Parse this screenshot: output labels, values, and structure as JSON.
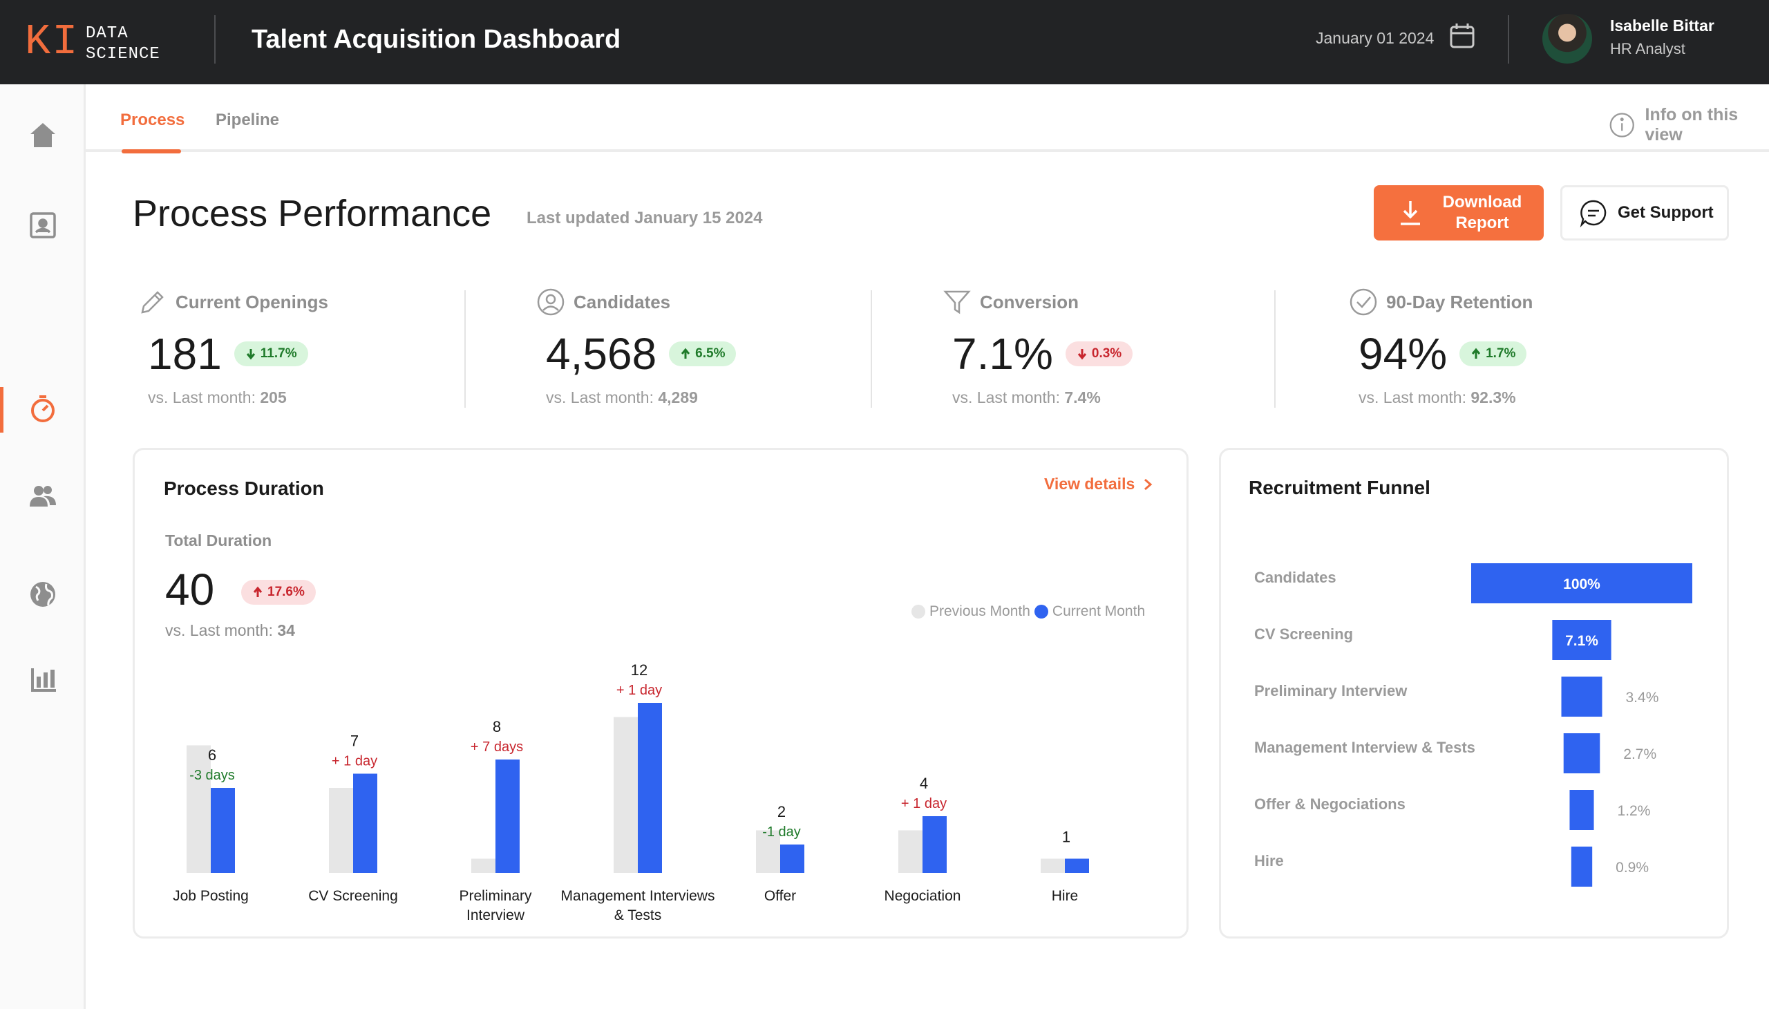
{
  "brand": {
    "logo_mark": "KI",
    "logo_text": "DATA\nSCIENCE",
    "accent": "#f26d3d"
  },
  "header": {
    "title": "Talent Acquisition Dashboard",
    "date": "January 01 2024",
    "user_name": "Isabelle Bittar",
    "user_role": "HR Analyst"
  },
  "sidebar": {
    "items": [
      {
        "icon": "home-icon",
        "active": false
      },
      {
        "icon": "id-card-icon",
        "active": false
      },
      {
        "icon": "timer-icon",
        "active": true
      },
      {
        "icon": "people-icon",
        "active": false
      },
      {
        "icon": "globe-icon",
        "active": false
      },
      {
        "icon": "bar-chart-icon",
        "active": false
      }
    ]
  },
  "tabs": {
    "process": "Process",
    "pipeline": "Pipeline",
    "active": "Process",
    "info": "Info on this view"
  },
  "page": {
    "title": "Process Performance",
    "last_updated": "Last updated January 15 2024",
    "download_label": "Download Report",
    "support_label": "Get Support"
  },
  "kpis": [
    {
      "label": "Current Openings",
      "icon": "pencil-icon",
      "value": "181",
      "change": "11.7%",
      "direction": "down",
      "tone": "green",
      "sub_label": "vs. Last month:",
      "sub_value": "205"
    },
    {
      "label": "Candidates",
      "icon": "user-circle-icon",
      "value": "4,568",
      "change": "6.5%",
      "direction": "up",
      "tone": "green",
      "sub_label": "vs. Last month:",
      "sub_value": "4,289"
    },
    {
      "label": "Conversion",
      "icon": "funnel-icon",
      "value": "7.1%",
      "change": "0.3%",
      "direction": "down",
      "tone": "red",
      "sub_label": "vs. Last month:",
      "sub_value": "7.4%"
    },
    {
      "label": "90-Day Retention",
      "icon": "check-circle-icon",
      "value": "94%",
      "change": "1.7%",
      "direction": "up",
      "tone": "green",
      "sub_label": "vs. Last month:",
      "sub_value": "92.3%"
    }
  ],
  "duration": {
    "title": "Process Duration",
    "view_details": "View details",
    "total_label": "Total Duration",
    "total_value": "40",
    "total_change": "17.6%",
    "total_sub_label": "vs. Last month:",
    "total_sub_value": "34",
    "legend_prev": "Previous Month",
    "legend_curr": "Current Month"
  },
  "chart_data": [
    {
      "type": "bar",
      "title": "Process Duration",
      "categories": [
        "Job Posting",
        "CV Screening",
        "Preliminary Interview",
        "Management Interviews & Tests",
        "Offer",
        "Negociation",
        "Hire"
      ],
      "series": [
        {
          "name": "Previous Month",
          "color": "#e6e6e6",
          "values": [
            9,
            6,
            1,
            11,
            3,
            3,
            1
          ]
        },
        {
          "name": "Current Month",
          "color": "#2f63f0",
          "values": [
            6,
            7,
            8,
            12,
            2,
            4,
            1
          ]
        }
      ],
      "value_labels": [
        "6",
        "7",
        "8",
        "12",
        "2",
        "4",
        "1"
      ],
      "delta_labels": [
        "-3 days",
        "+ 1 day",
        "+ 7 days",
        "+ 1 day",
        "-1 day",
        "+ 1 day",
        ""
      ],
      "delta_tones": [
        "green",
        "red",
        "red",
        "red",
        "green",
        "red",
        ""
      ],
      "ylim": [
        0,
        12
      ]
    },
    {
      "type": "bar",
      "title": "Recruitment Funnel",
      "orientation": "horizontal-centered",
      "categories": [
        "Candidates",
        "CV Screening",
        "Preliminary Interview",
        "Management Interview & Tests",
        "Offer & Negociations",
        "Hire"
      ],
      "values": [
        100,
        7.1,
        3.4,
        2.7,
        1.2,
        0.9
      ],
      "labels": [
        "100%",
        "7.1%",
        "3.4%",
        "2.7%",
        "1.2%",
        "0.9%"
      ],
      "color": "#2f63f0"
    }
  ],
  "colors": {
    "previous": "#e6e6e6",
    "current": "#2f63f0",
    "up_red": "#c8262e",
    "down_green": "#1f7a2a"
  }
}
